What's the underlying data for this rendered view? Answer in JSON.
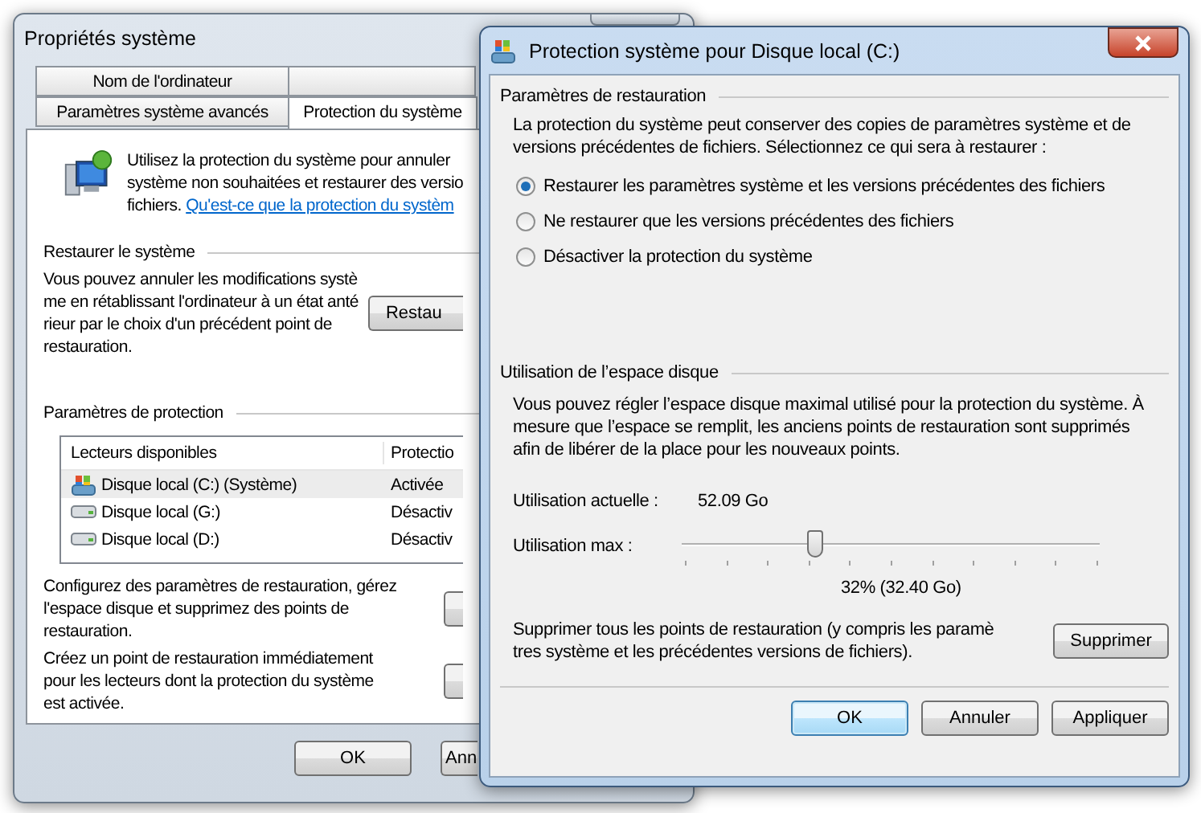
{
  "back_window": {
    "title": "Propriétés système",
    "tabs_row1": [
      {
        "label": "Nom de l'ordinateur",
        "selected": false
      },
      {
        "selected": false
      }
    ],
    "tabs_row2": [
      {
        "label": "Paramètres système avancés",
        "selected": false
      },
      {
        "label": "Protection du système",
        "selected": true
      }
    ],
    "intro_lines": [
      "Utilisez la protection du système pour annuler",
      "système non souhaitées et restaurer des versio",
      "fichiers."
    ],
    "intro_link": "Qu'est-ce que la protection du systèm",
    "restore_group": {
      "title": "Restaurer le système",
      "lines": [
        "Vous pouvez annuler les modifications systè",
        "me en rétablissant l'ordinateur à un état anté",
        "rieur par le choix d'un précédent point de",
        "restauration."
      ],
      "button": "Restau"
    },
    "protection_group": {
      "title": "Paramètres de protection",
      "table": {
        "columns": [
          "Lecteurs disponibles",
          "Protectio"
        ],
        "rows": [
          {
            "kind": "system",
            "drive": "Disque local (C:) (Système)",
            "protection": "Activée",
            "selected": true
          },
          {
            "kind": "disk",
            "drive": "Disque local (G:)",
            "protection": "Désactiv",
            "selected": false
          },
          {
            "kind": "disk",
            "drive": "Disque local (D:)",
            "protection": "Désactiv",
            "selected": false
          }
        ]
      },
      "configure_lines": [
        "Configurez des paramètres de restauration, gérez",
        "l'espace disque et supprimez des points de",
        "restauration."
      ],
      "create_lines": [
        "Créez un point de restauration immédiatement",
        "pour les lecteurs dont la protection du système",
        "est activée."
      ]
    },
    "buttons": [
      "OK",
      "Ann"
    ]
  },
  "front_window": {
    "title": "Protection système pour Disque local (C:)",
    "restore_settings": {
      "title": "Paramètres de restauration",
      "lines": [
        "La protection du système peut conserver des copies de paramètres système et de",
        "versions précédentes de fichiers. Sélectionnez ce qui sera à restaurer :"
      ],
      "options": [
        {
          "label": "Restaurer les paramètres système et les versions précédentes des fichiers",
          "selected": true
        },
        {
          "label": "Ne restaurer que les versions précédentes des fichiers",
          "selected": false
        },
        {
          "label": "Désactiver la protection du système",
          "selected": false
        }
      ]
    },
    "disk_usage": {
      "title": "Utilisation de l’espace disque",
      "lines": [
        "Vous pouvez régler l’espace disque maximal utilisé pour la protection du système. À",
        "mesure que l’espace se remplit, les anciens points de restauration sont supprimés",
        "afin de libérer de la place pour les nouveaux points."
      ],
      "current_label": "Utilisation actuelle :",
      "current_value": "52.09 Go",
      "max_label": "Utilisation max :",
      "level": 0.32,
      "max_reading": "32% (32.40 Go)",
      "delete_lines": [
        "Supprimer tous les points de restauration (y compris les paramè",
        "tres système et les précédentes versions de fichiers)."
      ],
      "delete_button": "Supprimer"
    },
    "buttons": [
      {
        "label": "OK",
        "default": true
      },
      {
        "label": "Annuler",
        "default": false
      },
      {
        "label": "Appliquer",
        "default": false
      }
    ]
  }
}
